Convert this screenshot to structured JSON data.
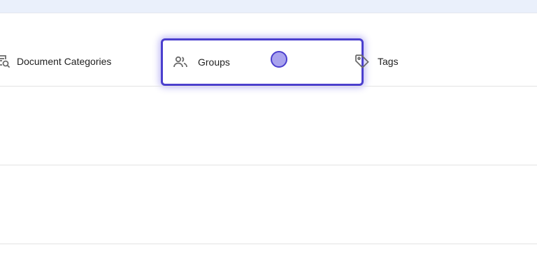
{
  "tabs": [
    {
      "label": "Document Categories",
      "icon": "document-search-icon"
    },
    {
      "label": "Groups",
      "icon": "people-icon",
      "highlighted": true
    },
    {
      "label": "Tags",
      "icon": "tag-icon"
    }
  ],
  "colors": {
    "highlight_border": "#4b3fce",
    "top_band": "#eaf0fb",
    "icon": "#6b6b6b"
  }
}
